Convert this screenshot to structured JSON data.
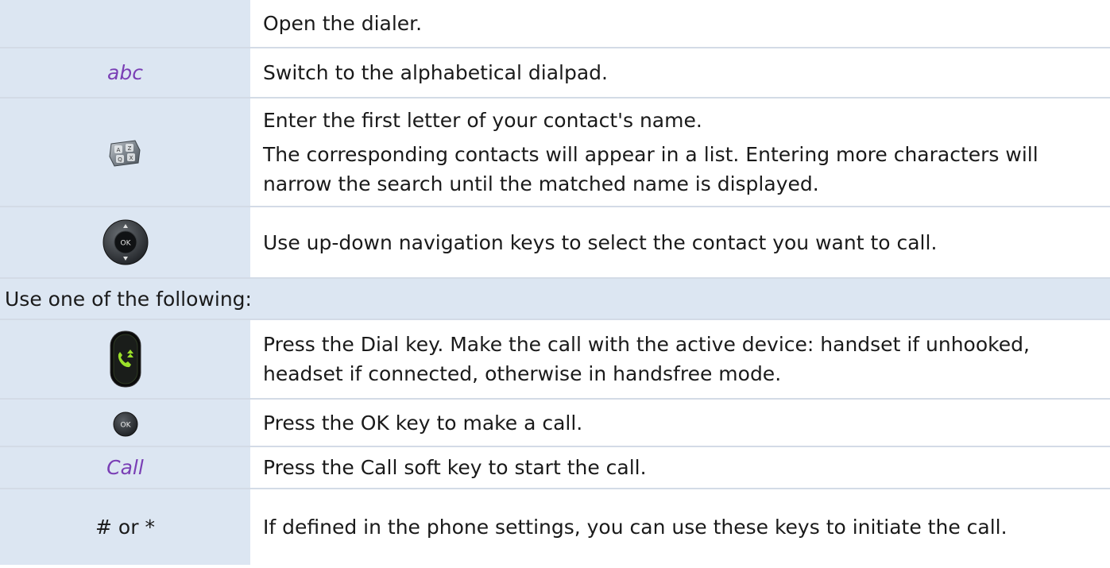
{
  "rows": {
    "open_dialer": {
      "icon": "",
      "text": "Open the dialer."
    },
    "alpha_dialpad": {
      "key": "abc",
      "text": "Switch to the alphabetical dialpad."
    },
    "first_letter": {
      "icon": "alphabetic-keypad-icon",
      "text1": "Enter the first letter of your contact's name.",
      "text2": "The corresponding contacts will appear in a list. Entering more characters will narrow the search until the matched name is displayed."
    },
    "navigate": {
      "icon": "navigator-ok-icon",
      "nav_ok_label": "OK",
      "text": "Use up-down navigation keys to select the contact you want to call."
    },
    "header": {
      "text": "Use one of the following:"
    },
    "dial_key": {
      "icon": "dial-key-icon",
      "text": "Press the Dial key. Make the call with the active device: handset if unhooked, headset if connected, otherwise in handsfree mode."
    },
    "ok_key": {
      "icon": "ok-key-icon",
      "ok_label": "OK",
      "text": "Press the OK key to make a call."
    },
    "call_softkey": {
      "key": "Call",
      "text": "Press the Call soft key to start the call."
    },
    "hash_star": {
      "key": "# or *",
      "text": "If defined in the phone settings, you can use these keys to initiate the call."
    }
  },
  "colors": {
    "cell_background": "#dce6f2",
    "softkey_text": "#7a3fb5",
    "body_text": "#1a1a1a"
  }
}
